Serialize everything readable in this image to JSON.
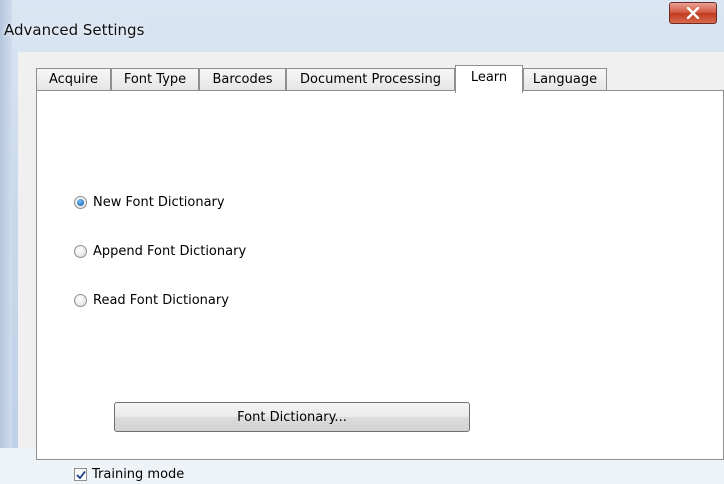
{
  "window": {
    "title": "Advanced Settings"
  },
  "tabs": [
    {
      "label": "Acquire",
      "active": false
    },
    {
      "label": "Font Type",
      "active": false
    },
    {
      "label": "Barcodes",
      "active": false
    },
    {
      "label": "Document Processing",
      "active": false
    },
    {
      "label": "Learn",
      "active": true
    },
    {
      "label": "Language",
      "active": false
    }
  ],
  "learn": {
    "options": [
      {
        "label": "New Font Dictionary",
        "checked": true
      },
      {
        "label": "Append Font Dictionary",
        "checked": false
      },
      {
        "label": "Read Font Dictionary",
        "checked": false
      }
    ],
    "font_dictionary_button": "Font Dictionary...",
    "training_mode": {
      "label": "Training mode",
      "checked": true
    }
  },
  "icons": {
    "close": "close-icon",
    "check": "checkmark-icon"
  },
  "colors": {
    "close_button": "#c03a1e",
    "radio_selected": "#2f7fc8",
    "check_mark": "#1a3f8a"
  }
}
